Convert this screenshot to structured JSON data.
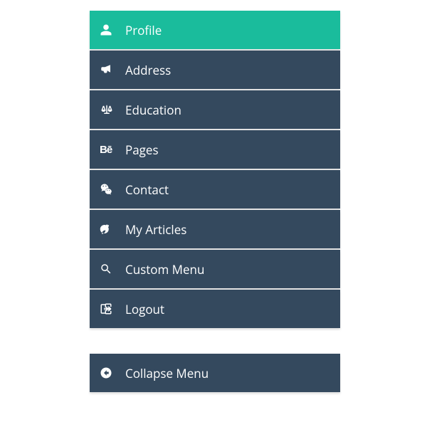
{
  "colors": {
    "accent": "#1abc9c",
    "item_bg": "#34495e",
    "text": "#ffffff"
  },
  "menu": {
    "items": [
      {
        "label": "Profile",
        "icon": "user-icon",
        "active": true
      },
      {
        "label": "Address",
        "icon": "bullhorn-icon",
        "active": false
      },
      {
        "label": "Education",
        "icon": "balance-scale-icon",
        "active": false
      },
      {
        "label": "Pages",
        "icon": "behance-icon",
        "active": false
      },
      {
        "label": "Contact",
        "icon": "wechat-icon",
        "active": false
      },
      {
        "label": "My Articles",
        "icon": "bomb-icon",
        "active": false
      },
      {
        "label": "Custom Menu",
        "icon": "search-icon",
        "active": false
      },
      {
        "label": "Logout",
        "icon": "sign-out-icon",
        "active": false
      }
    ]
  },
  "collapse": {
    "label": "Collapse Menu",
    "icon": "arrow-circle-left-icon"
  }
}
